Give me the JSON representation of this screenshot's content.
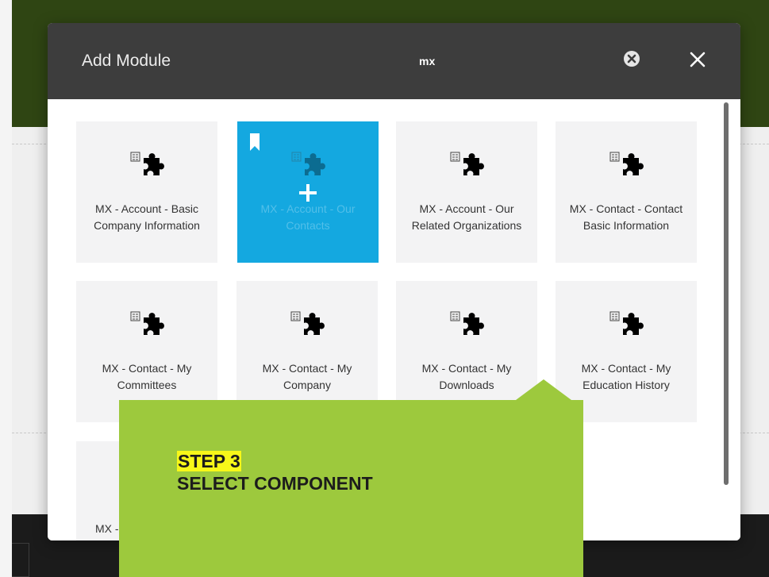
{
  "modal": {
    "title": "Add Module",
    "search_value": "mx"
  },
  "modules": [
    {
      "line1": "MX - Account - Basic",
      "line2": "Company Information",
      "selected": false
    },
    {
      "line1": "MX - Account - Our",
      "line2": "Contacts",
      "selected": true
    },
    {
      "line1": "MX - Account - Our",
      "line2": "Related Organizations",
      "selected": false
    },
    {
      "line1": "MX - Contact - Contact",
      "line2": "Basic Information",
      "selected": false
    },
    {
      "line1": "MX - Contact - My",
      "line2": "Committees",
      "selected": false
    },
    {
      "line1": "MX - Contact - My",
      "line2": "Company",
      "selected": false
    },
    {
      "line1": "MX - Contact - My",
      "line2": "Downloads",
      "selected": false
    },
    {
      "line1": "MX - Contact - My",
      "line2": "Education History",
      "selected": false
    },
    {
      "line1": "MX -",
      "line2": "",
      "selected": false
    }
  ],
  "callout": {
    "step": "STEP 3",
    "title": "SELECT COMPONENT"
  },
  "colors": {
    "header": "#3d3d3d",
    "selected_tile": "#14a8e0",
    "callout": "#9dc93d",
    "step_highlight": "#f7f719",
    "page_top": "#2f4513"
  }
}
